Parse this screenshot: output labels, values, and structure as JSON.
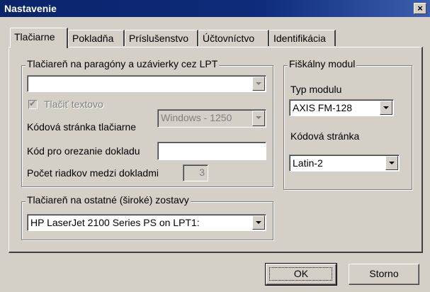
{
  "window": {
    "title": "Nastavenie",
    "close_glyph": "×"
  },
  "tabs": [
    {
      "label": "Tlačiarne",
      "active": true
    },
    {
      "label": "Pokladňa"
    },
    {
      "label": "Príslušenstvo"
    },
    {
      "label": "Účtovníctvo"
    },
    {
      "label": "Identifikácia"
    }
  ],
  "lpt_group": {
    "legend": "Tlačiareň na paragóny a uzávierky cez LPT",
    "printer_value": "",
    "print_text_label": "Tlačiť textovo",
    "print_text_checked": true,
    "codepage_label": "Kódová stránka tlačiarne",
    "codepage_value": "Windows - 1250",
    "cut_code_label": "Kód pro orezanie dokladu",
    "cut_code_value": "",
    "lines_label": "Počet riadkov medzi dokladmi",
    "lines_value": "3"
  },
  "fiscal_group": {
    "legend": "Fiškálny modul",
    "type_label": "Typ modulu",
    "type_value": "AXIS FM-128",
    "codepage_label": "Kódová stránka",
    "codepage_value": "Latin-2"
  },
  "wide_group": {
    "legend": "Tlačiareň na ostatné (široké) zostavy",
    "printer_value": "HP LaserJet 2100 Series PS on LPT1:"
  },
  "buttons": {
    "ok": "OK",
    "cancel": "Storno"
  }
}
